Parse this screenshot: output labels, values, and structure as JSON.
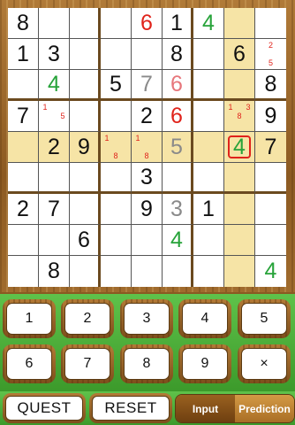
{
  "board": {
    "cells": [
      [
        "8",
        "",
        "",
        "",
        "6",
        "1",
        "4",
        "",
        ""
      ],
      [
        "1",
        "3",
        "",
        "",
        "",
        "8",
        "",
        "6",
        ""
      ],
      [
        "",
        "4",
        "",
        "5",
        "7",
        "6",
        "",
        "",
        "8"
      ],
      [
        "7",
        "",
        "",
        "",
        "2",
        "6",
        "",
        "",
        "9"
      ],
      [
        "",
        "2",
        "9",
        "",
        "",
        "5",
        "",
        "4",
        "7"
      ],
      [
        "",
        "",
        "",
        "",
        "3",
        "",
        "",
        "",
        ""
      ],
      [
        "2",
        "7",
        "",
        "",
        "9",
        "3",
        "1",
        "",
        ""
      ],
      [
        "",
        "",
        "6",
        "",
        "",
        "4",
        "",
        "",
        ""
      ],
      [
        "",
        "8",
        "",
        "",
        "",
        "",
        "",
        "",
        "4"
      ]
    ],
    "cell_colors": [
      [
        "black",
        "",
        "",
        "",
        "red",
        "black",
        "green",
        "",
        ""
      ],
      [
        "black",
        "black",
        "",
        "",
        "",
        "black",
        "",
        "black",
        ""
      ],
      [
        "",
        "green",
        "",
        "black",
        "gray",
        "pink",
        "",
        "",
        "black"
      ],
      [
        "black",
        "",
        "",
        "",
        "black",
        "red",
        "",
        "",
        "black"
      ],
      [
        "",
        "black",
        "black",
        "",
        "",
        "gray",
        "",
        "green",
        "black"
      ],
      [
        "",
        "",
        "",
        "",
        "black",
        "",
        "",
        "",
        ""
      ],
      [
        "black",
        "black",
        "",
        "",
        "black",
        "gray",
        "black",
        "",
        ""
      ],
      [
        "",
        "",
        "black",
        "",
        "",
        "green",
        "",
        "",
        ""
      ],
      [
        "",
        "black",
        "",
        "",
        "",
        "",
        "",
        "",
        "green"
      ]
    ],
    "notes": {
      "1-8": [
        "",
        "2",
        "",
        "",
        "",
        "",
        "",
        "5",
        ""
      ],
      "3-1": [
        "1",
        "",
        "",
        "",
        "",
        "5",
        "",
        "",
        ""
      ],
      "3-7": [
        "1",
        "",
        "3",
        "",
        "8",
        "",
        "",
        "",
        ""
      ],
      "4-3": [
        "1",
        "",
        "",
        "",
        "",
        "",
        "",
        "8",
        ""
      ],
      "4-4": [
        "1",
        "",
        "",
        "",
        "",
        "",
        "",
        "8",
        ""
      ]
    },
    "highlight_row": 4,
    "highlight_col": 7,
    "selected": [
      4,
      7
    ]
  },
  "keypad": {
    "keys": [
      "1",
      "2",
      "3",
      "4",
      "5",
      "6",
      "7",
      "8",
      "9",
      "×"
    ]
  },
  "bottom": {
    "quest_label": "QUEST",
    "reset_label": "RESET",
    "mode_input": "Input",
    "mode_prediction": "Prediction",
    "active_mode": "Prediction"
  }
}
